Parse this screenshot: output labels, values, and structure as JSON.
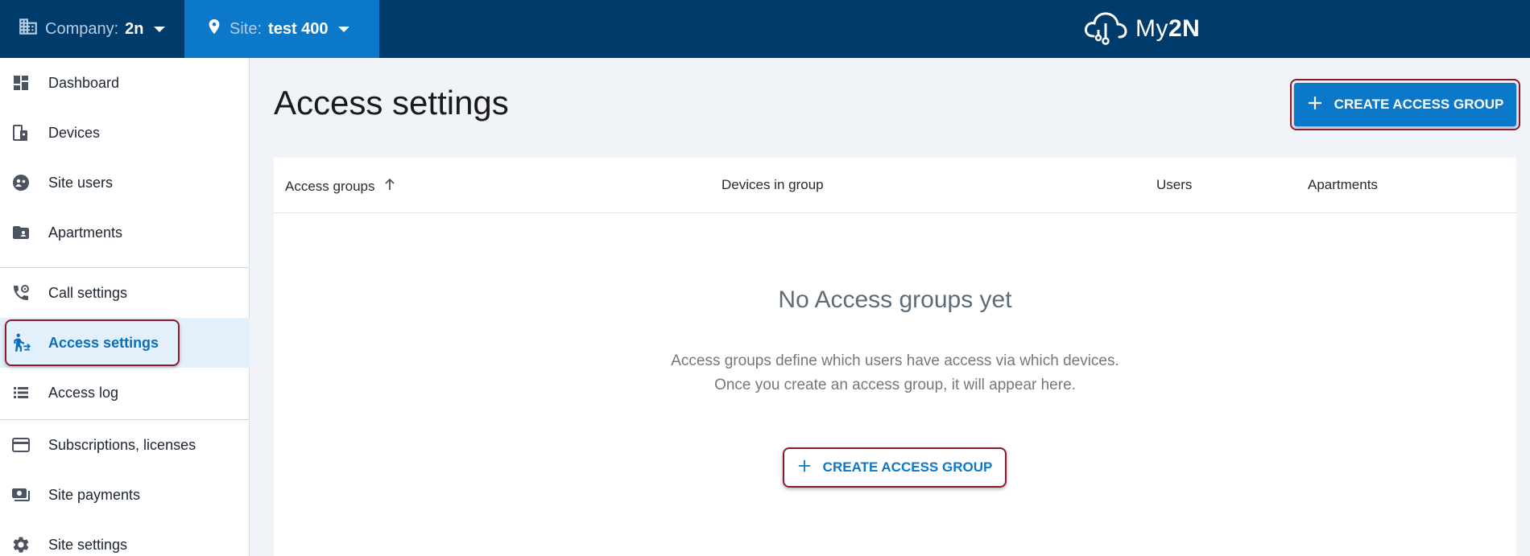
{
  "topbar": {
    "company_label": "Company:",
    "company_value": "2n",
    "site_label": "Site:",
    "site_value": "test 400",
    "logo_text_a": "My",
    "logo_text_b": "2N"
  },
  "sidebar": {
    "items": [
      {
        "label": "Dashboard",
        "icon": "dashboard-icon"
      },
      {
        "label": "Devices",
        "icon": "devices-icon"
      },
      {
        "label": "Site users",
        "icon": "site-users-icon"
      },
      {
        "label": "Apartments",
        "icon": "apartments-icon"
      },
      {
        "label": "Call settings",
        "icon": "call-settings-icon"
      },
      {
        "label": "Access settings",
        "icon": "access-settings-icon",
        "active": true
      },
      {
        "label": "Access log",
        "icon": "access-log-icon"
      },
      {
        "label": "Subscriptions, licenses",
        "icon": "credit-card-icon"
      },
      {
        "label": "Site payments",
        "icon": "payments-icon"
      },
      {
        "label": "Site settings",
        "icon": "gear-icon"
      }
    ]
  },
  "main": {
    "title": "Access settings",
    "create_button_label": "CREATE ACCESS GROUP",
    "table": {
      "columns": [
        "Access groups",
        "Devices in group",
        "Users",
        "Apartments"
      ]
    },
    "empty_state": {
      "title": "No Access groups yet",
      "line1": "Access groups define which users have access via which devices.",
      "line2": "Once you create an access group, it will appear here.",
      "button_label": "CREATE ACCESS GROUP"
    }
  },
  "colors": {
    "topbar": "#003c6b",
    "site_selector": "#0b78c9",
    "accent": "#0b78c9",
    "highlight": "#8b1a2e"
  }
}
